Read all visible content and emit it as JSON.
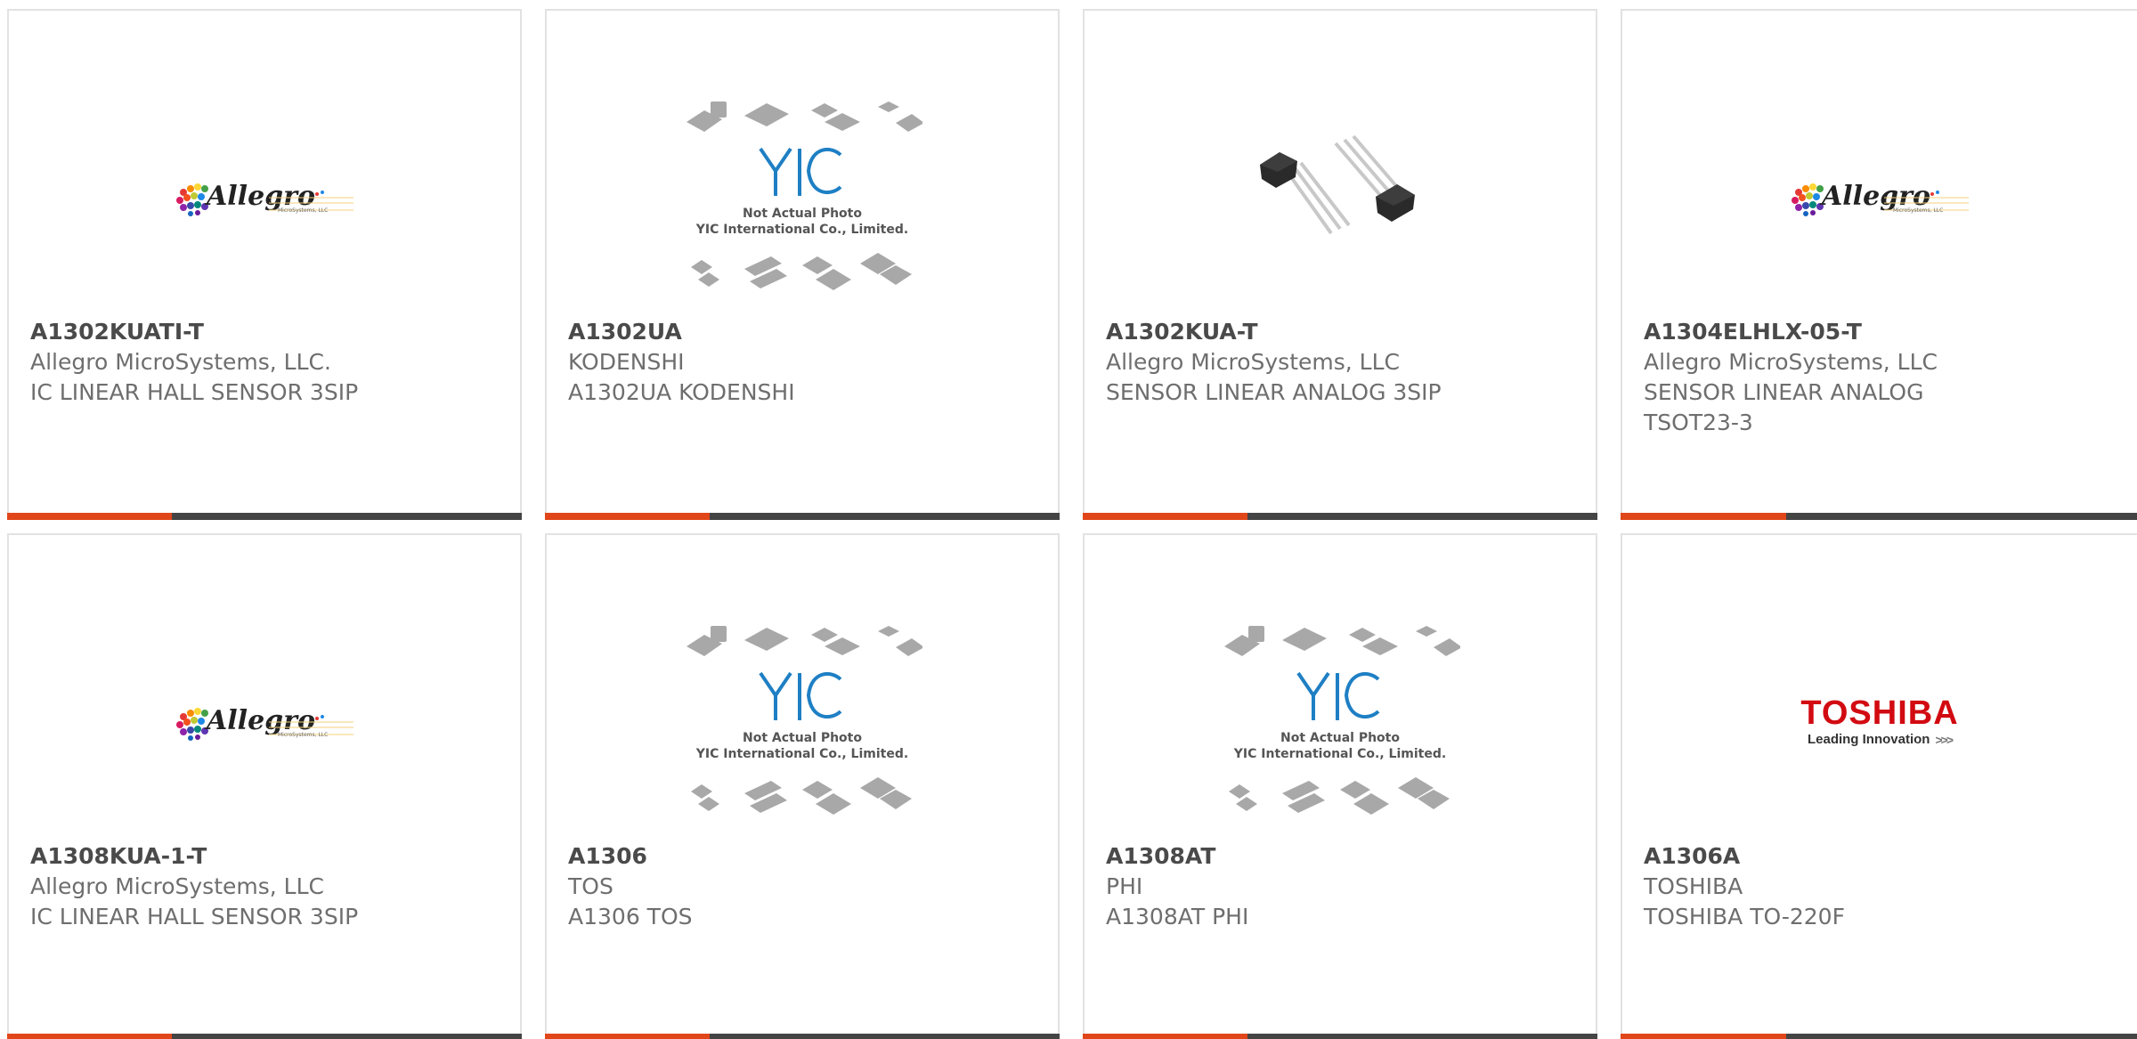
{
  "products": [
    {
      "part": "A1302KUATI-T",
      "manufacturer": "Allegro MicroSystems, LLC.",
      "description": "IC LINEAR HALL SENSOR 3SIP",
      "image": "allegro-logo"
    },
    {
      "part": "A1302UA",
      "manufacturer": "KODENSHI",
      "description": "A1302UA KODENSHI",
      "image": "yic-placeholder"
    },
    {
      "part": "A1302KUA-T",
      "manufacturer": "Allegro MicroSystems, LLC",
      "description": "SENSOR LINEAR ANALOG 3SIP",
      "image": "sensor-photo"
    },
    {
      "part": "A1304ELHLX-05-T",
      "manufacturer": "Allegro MicroSystems, LLC",
      "description": "SENSOR LINEAR ANALOG TSOT23-3",
      "image": "allegro-logo"
    },
    {
      "part": "A1308KUA-1-T",
      "manufacturer": "Allegro MicroSystems, LLC",
      "description": "IC LINEAR HALL SENSOR 3SIP",
      "image": "allegro-logo"
    },
    {
      "part": "A1306",
      "manufacturer": "TOS",
      "description": "A1306 TOS",
      "image": "yic-placeholder"
    },
    {
      "part": "A1308AT",
      "manufacturer": "PHI",
      "description": "A1308AT PHI",
      "image": "yic-placeholder"
    },
    {
      "part": "A1306A",
      "manufacturer": "TOSHIBA",
      "description": "TOSHIBA TO-220F",
      "image": "toshiba-logo"
    }
  ],
  "logos": {
    "allegro_word": "Allegro",
    "allegro_sub": "MicroSystems, LLC",
    "toshiba_word": "TOSHIBA",
    "toshiba_tag": "Leading Innovation",
    "toshiba_chevrons": ">>>",
    "yic_mark": "YIC",
    "placeholder_line1": "Not Actual Photo",
    "placeholder_line2": "YIC International Co., Limited."
  },
  "colors": {
    "accent": "#e0461a",
    "bar_dark": "#444444",
    "toshiba_red": "#d20a11",
    "yic_blue": "#1e7fc4"
  }
}
